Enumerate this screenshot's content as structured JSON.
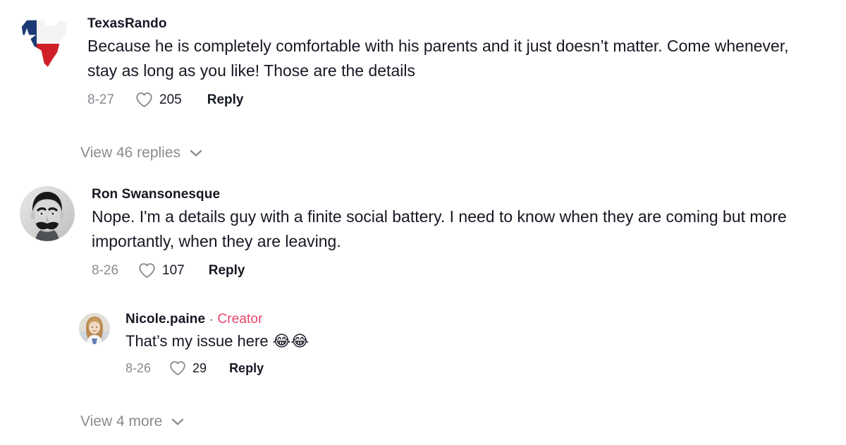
{
  "theme": {
    "background": "#ffffff",
    "text_primary": "#161823",
    "text_muted": "#8a8b91",
    "creator_accent": "#e8436c"
  },
  "comments": [
    {
      "id": "comment-1",
      "username": "TexasRando",
      "avatar": "texas-flag-state-avatar",
      "text": "Because he is completely comfortable with his parents and it just doesn’t matter. Come whenever, stay as long as you like! Those are the details",
      "date": "8-27",
      "like_icon": "heart-icon",
      "like_count": "205",
      "reply_label": "Reply"
    },
    {
      "id": "comment-2",
      "username": "Ron Swansonesque",
      "avatar": "mustache-man-portrait-avatar",
      "text": "Nope. I'm a details guy with a finite social battery. I need to know when they are coming but more importantly, when they are leaving.",
      "date": "8-26",
      "like_icon": "heart-icon",
      "like_count": "107",
      "reply_label": "Reply"
    },
    {
      "id": "comment-3",
      "username": "Nicole.paine",
      "avatar": "blonde-woman-portrait-avatar",
      "separator": "·",
      "badge": "Creator",
      "text": "That’s my issue here ",
      "emoji": "😂😂",
      "date": "8-26",
      "like_icon": "heart-icon",
      "like_count": "29",
      "reply_label": "Reply"
    }
  ],
  "view_replies": {
    "label": "View 46 replies",
    "icon": "chevron-down-icon"
  },
  "view_more": {
    "label": "View 4 more",
    "icon": "chevron-down-icon"
  }
}
